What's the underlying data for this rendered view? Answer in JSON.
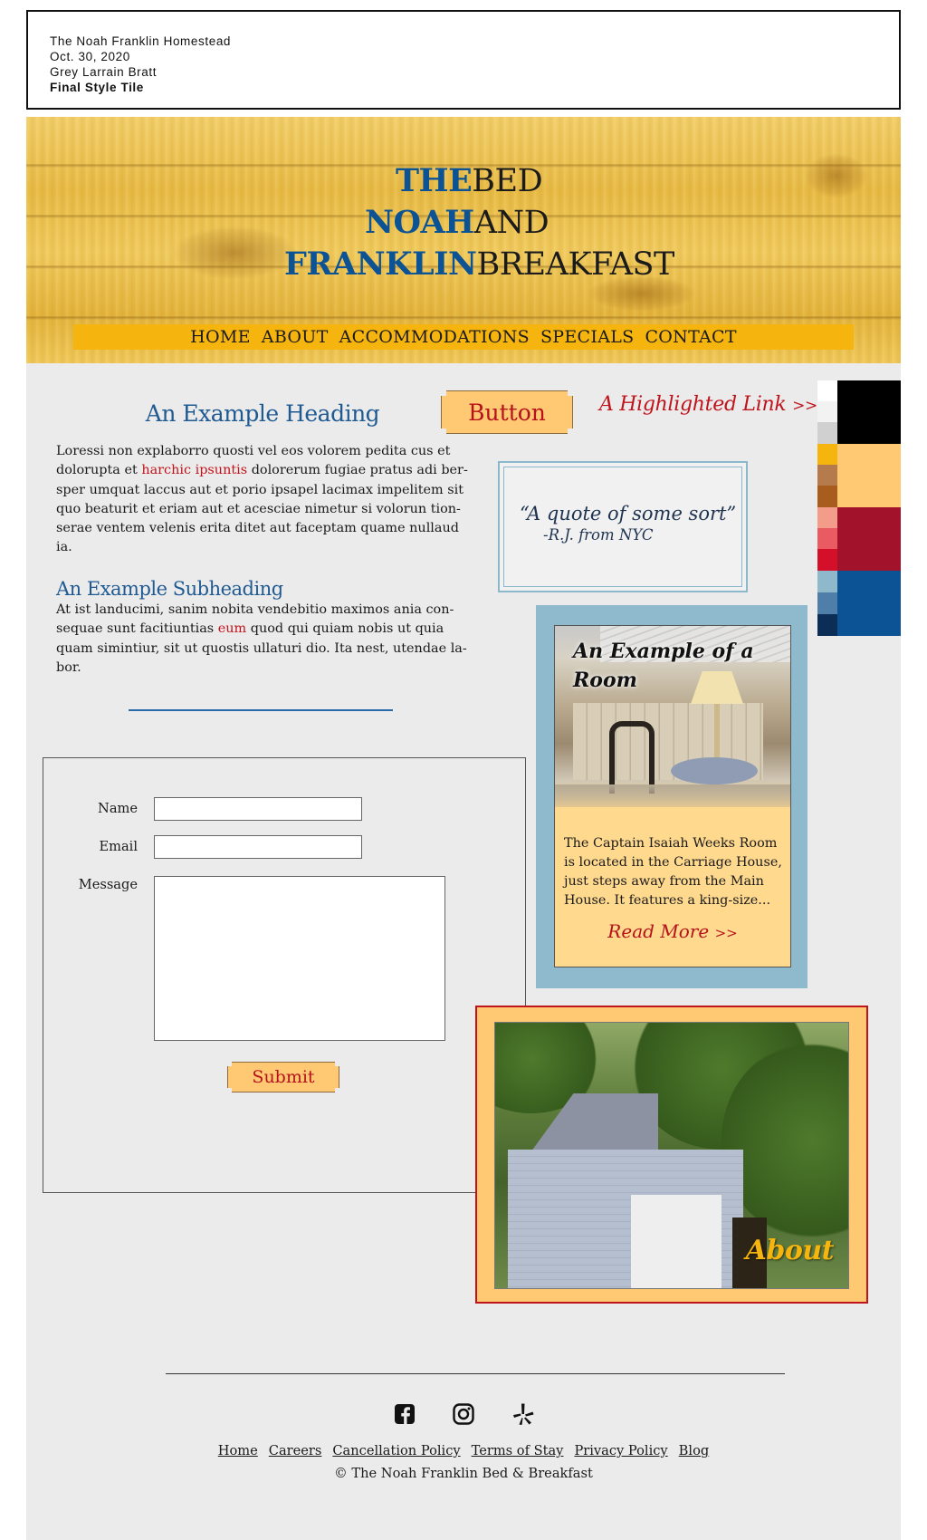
{
  "info": {
    "line1": "The Noah Franklin Homestead",
    "line2": "Oct. 30, 2020",
    "line3": "Grey Larrain Bratt",
    "line4": "Final Style Tile"
  },
  "banner": {
    "title_blue": [
      "THE",
      "NOAH",
      "FRANKLIN"
    ],
    "title_dark": [
      "BED",
      "AND",
      "BREAKFAST"
    ],
    "nav": [
      "HOME",
      "ABOUT",
      "ACCOMMODATIONS",
      "SPECIALS",
      "CONTACT"
    ]
  },
  "content": {
    "heading": "An Example Heading",
    "p1_a": "Loressi non explaborro quosti vel eos volorem pedita cus et dolorupta et ",
    "p1_link": "harchic ipsuntis",
    "p1_b": " dolorerum fugiae pratus adi ber-sper umquat laccus aut et porio ipsapel lacimax impelitem sit quo beaturit et eriam aut et acesciae nimetur si volorun tion-serae ventem velenis erita ditet aut faceptam quame nullaud ia.",
    "subheading": "An Example Subheading",
    "p2_a": "At ist landucimi, sanim nobita vendebitio maximos ania con-sequae sunt facitiuntias ",
    "p2_link": "eum",
    "p2_b": " quod qui quiam nobis ut quia quam simintiur, sit ut quostis ullaturi dio. Ita nest, utendae la-bor."
  },
  "button_sample": "Button",
  "highlight_link": {
    "text": "A Highlighted Link ",
    "arrow": ">>"
  },
  "quote": {
    "text": "“A quote of some sort”",
    "attribution": "-R.J. from NYC"
  },
  "palette": {
    "small": [
      "#ffffff",
      "#f2f2f2",
      "#d0d0d0",
      "#f6b40f",
      "#b57b4c",
      "#a85d1e",
      "#f39c8a",
      "#ea5a63",
      "#d40f2a",
      "#8fb8cb",
      "#4f7fa8",
      "#0c2d55"
    ],
    "large": [
      "#000000",
      "#ffc873",
      "#a3122b",
      "#0b5394"
    ]
  },
  "room": {
    "title": "An Example of a Room",
    "description": "The Captain Isaiah Weeks Room is located in the Carriage House, just steps away from the Main House. It features a king-size...",
    "read_more": "Read More ",
    "arrow": ">>"
  },
  "form": {
    "name_label": "Name",
    "email_label": "Email",
    "message_label": "Message",
    "submit": "Submit"
  },
  "about": {
    "label": "About"
  },
  "footer": {
    "social": [
      "facebook-icon",
      "instagram-icon",
      "yelp-icon"
    ],
    "links": [
      "Home",
      "Careers",
      "Cancellation Policy",
      "Terms of Stay",
      "Privacy Policy",
      "Blog"
    ],
    "copyright": "© The Noah Franklin Bed & Breakfast"
  }
}
